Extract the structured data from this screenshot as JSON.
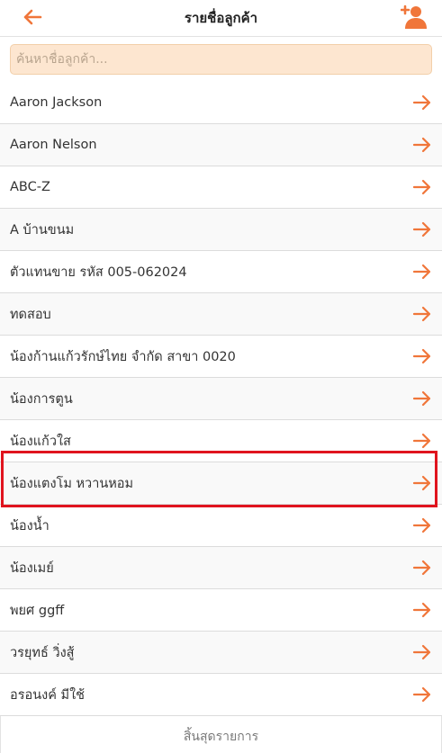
{
  "header": {
    "title": "รายชื่อลูกค้า",
    "back_icon": "arrow-left-icon",
    "add_icon": "add-user-icon"
  },
  "search": {
    "placeholder": "ค้นหาชื่อลูกค้า...",
    "value": ""
  },
  "customers": [
    {
      "name": "Aaron Jackson"
    },
    {
      "name": "Aaron Nelson"
    },
    {
      "name": "ABC-Z"
    },
    {
      "name": "A บ้านขนม"
    },
    {
      "name": "ตัวแทนขาย รหัส 005-062024"
    },
    {
      "name": "ทดสอบ"
    },
    {
      "name": "น้องก้านแก้วรักษ์ไทย จำกัด สาขา 0020"
    },
    {
      "name": "น้องการตูน"
    },
    {
      "name": "น้องแก้วใส"
    },
    {
      "name": "น้องแตงโม หวานหอม"
    },
    {
      "name": "น้องน้ำ"
    },
    {
      "name": "น้องเมย์"
    },
    {
      "name": "พยศ ggff"
    },
    {
      "name": "วรยุทธ์ วิ่งสู้"
    },
    {
      "name": "อรอนงค์ มีใช้"
    }
  ],
  "selected_index": 9,
  "footer": {
    "text": "สิ้นสุดรายการ"
  },
  "colors": {
    "accent": "#f0763a",
    "highlight": "#e0141e",
    "search_bg": "#fde6d0"
  }
}
